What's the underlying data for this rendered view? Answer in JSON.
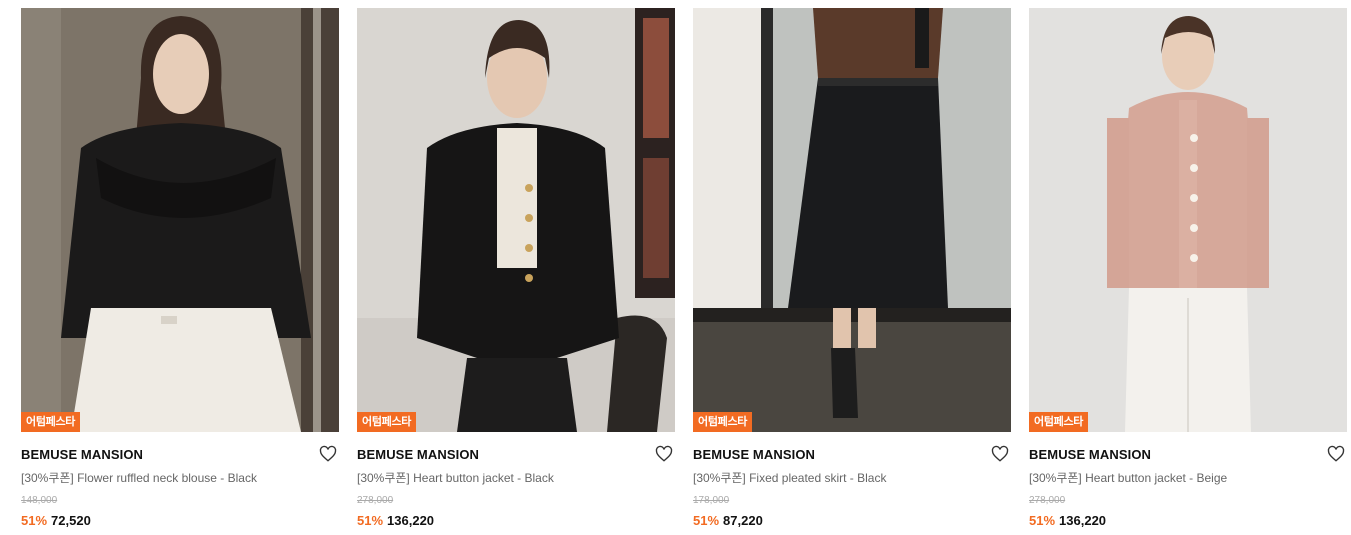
{
  "colors": {
    "accent": "#f26b22",
    "muted_text": "#666666",
    "strike_text": "#aaaaaa"
  },
  "products": [
    {
      "badge": "어텀페스타",
      "brand": "BEMUSE MANSION",
      "name": "[30%쿠폰] Flower ruffled neck blouse - Black",
      "original_price": "148,000",
      "discount": "51%",
      "price": "72,520",
      "image": "woman in black ruffled blouse and white skirt",
      "wishlist_icon": "heart-outline-icon"
    },
    {
      "badge": "어텀페스타",
      "brand": "BEMUSE MANSION",
      "name": "[30%쿠폰] Heart button jacket - Black",
      "original_price": "278,000",
      "discount": "51%",
      "price": "136,220",
      "image": "woman in black jacket with gold heart buttons",
      "wishlist_icon": "heart-outline-icon"
    },
    {
      "badge": "어텀페스타",
      "brand": "BEMUSE MANSION",
      "name": "[30%쿠폰] Fixed pleated skirt - Black",
      "original_price": "178,000",
      "discount": "51%",
      "price": "87,220",
      "image": "black pleated midi skirt with brown top",
      "wishlist_icon": "heart-outline-icon"
    },
    {
      "badge": "어텀페스타",
      "brand": "BEMUSE MANSION",
      "name": "[30%쿠폰] Heart button jacket - Beige",
      "original_price": "278,000",
      "discount": "51%",
      "price": "136,220",
      "image": "woman in beige tweed jacket and white pants",
      "wishlist_icon": "heart-outline-icon"
    }
  ]
}
